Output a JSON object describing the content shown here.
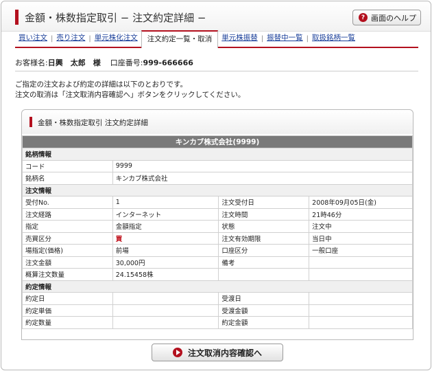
{
  "header": {
    "title": "金額・株数指定取引 − 注文約定詳細 −",
    "help_label": "画面のヘルプ",
    "help_icon": "?"
  },
  "tabs": [
    {
      "label": "買い注文",
      "active": false
    },
    {
      "label": "売り注文",
      "active": false
    },
    {
      "label": "単元株化注文",
      "active": false
    },
    {
      "label": "注文約定一覧・取消",
      "active": true
    },
    {
      "label": "単元株振替",
      "active": false
    },
    {
      "label": "振替中一覧",
      "active": false
    },
    {
      "label": "取扱銘柄一覧",
      "active": false
    }
  ],
  "customer": {
    "prefix": "お客様名:",
    "name": "日興　太郎　様",
    "account_label": "口座番号:",
    "account_number": "999-666666"
  },
  "notice": [
    "ご指定の注文および約定の詳細は以下のとおりです。",
    "注文の取消は「注文取消内容確認へ」ボタンをクリックしてください。"
  ],
  "panel": {
    "title": "金額・株数指定取引 注文約定詳細"
  },
  "company": "キンカブ株式会社(9999)",
  "stock_info": {
    "section": "銘柄情報",
    "code_label": "コード",
    "code": "9999",
    "name_label": "銘柄名",
    "name": "キンカブ株式会社"
  },
  "order_info": {
    "section": "注文情報",
    "rows": [
      [
        "受付No.",
        "1",
        "注文受付日",
        "2008年09月05日(金)"
      ],
      [
        "注文経路",
        "インターネット",
        "注文時間",
        "21時46分"
      ],
      [
        "指定",
        "金額指定",
        "状態",
        "注文中"
      ],
      [
        "売買区分",
        "買",
        "注文有効期限",
        "当日中"
      ],
      [
        "場指定(価格)",
        "前場",
        "口座区分",
        "一般口座"
      ],
      [
        "注文金額",
        "30,000円",
        "備考",
        ""
      ],
      [
        "概算注文数量",
        "24.15458株",
        "",
        ""
      ]
    ]
  },
  "execution_info": {
    "section": "約定情報",
    "rows": [
      [
        "約定日",
        "",
        "受渡日",
        ""
      ],
      [
        "約定単価",
        "",
        "受渡金額",
        ""
      ],
      [
        "約定数量",
        "",
        "約定金額",
        ""
      ]
    ]
  },
  "submit": {
    "label": "注文取消内容確認へ"
  },
  "colors": {
    "accent": "#b3101e",
    "link": "#1a3f9a",
    "company_bar": "#7a7a7a",
    "buy_text": "#c0141e"
  }
}
